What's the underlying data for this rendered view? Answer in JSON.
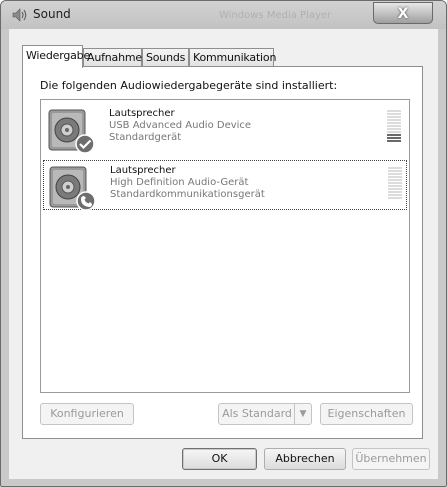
{
  "window": {
    "title": "Sound",
    "background_title": "Windows Media Player",
    "close_label": "X"
  },
  "tabs": [
    {
      "label": "Wiedergabe",
      "active": true
    },
    {
      "label": "Aufnahme",
      "active": false
    },
    {
      "label": "Sounds",
      "active": false
    },
    {
      "label": "Kommunikation",
      "active": false
    }
  ],
  "panel": {
    "heading": "Die folgenden Audiowiedergabegeräte sind installiert:"
  },
  "devices": [
    {
      "name": "Lautsprecher",
      "description": "USB Advanced Audio Device",
      "status": "Standardgerät",
      "badge": "checkmark-icon",
      "meter_level": 0.3
    },
    {
      "name": "Lautsprecher",
      "description": "High Definition Audio-Gerät",
      "status": "Standardkommunikationsgerät",
      "badge": "phone-icon",
      "meter_level": 0
    }
  ],
  "buttons": {
    "configure": "Konfigurieren",
    "set_default": "Als Standard",
    "properties": "Eigenschaften",
    "ok": "OK",
    "cancel": "Abbrechen",
    "apply": "Übernehmen"
  },
  "colors": {
    "window_frame": "#c9c9c9",
    "client": "#f0f0f0",
    "secondary_text": "#777777"
  }
}
